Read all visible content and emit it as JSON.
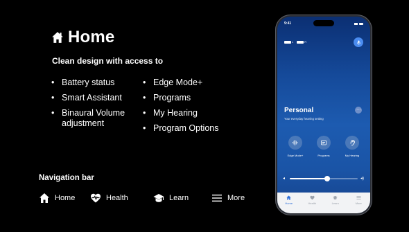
{
  "slide": {
    "title": "Home",
    "subtitle": "Clean design with access to",
    "features_col1": [
      "Battery status",
      "Smart Assistant",
      "Binaural Volume adjustment"
    ],
    "features_col2": [
      "Edge Mode+",
      "Programs",
      "My Hearing",
      "Program Options"
    ],
    "nav_heading": "Navigation bar",
    "nav_items": [
      "Home",
      "Health",
      "Learn",
      "More"
    ]
  },
  "phone": {
    "time": "9:41",
    "battery_left": "L",
    "battery_right": "R",
    "program_name": "Personal",
    "program_desc": "Your everyday hearing setting",
    "controls": [
      "Edge Mode+",
      "Programs",
      "My Hearing"
    ],
    "volume_level": 0.55,
    "tabs": [
      "Home",
      "Health",
      "Learn",
      "More"
    ],
    "active_tab": "Home"
  },
  "colors": {
    "background": "#000000",
    "accent": "#2f6fd8",
    "screen_top": "#0b2f73",
    "screen_mid": "#1d5bb0"
  },
  "icons": {
    "title": "house-icon",
    "nav": [
      "house-icon",
      "heart-pulse-icon",
      "graduation-cap-icon",
      "menu-icon"
    ]
  }
}
